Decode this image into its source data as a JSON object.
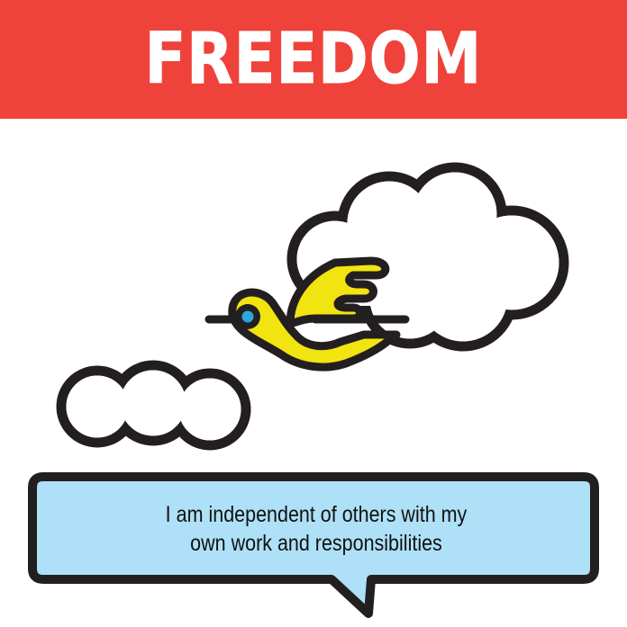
{
  "banner": {
    "title": "FREEDOM",
    "color": "#ef423a"
  },
  "illustration": {
    "subject": "bird-flying-between-clouds",
    "bird_color": "#f2e410",
    "eye_color": "#2ba6de",
    "outline_color": "#231f20"
  },
  "caption": {
    "line1": "I am independent of others with my",
    "line2": "own work and responsibilities",
    "bubble_color": "#aee0f7"
  }
}
